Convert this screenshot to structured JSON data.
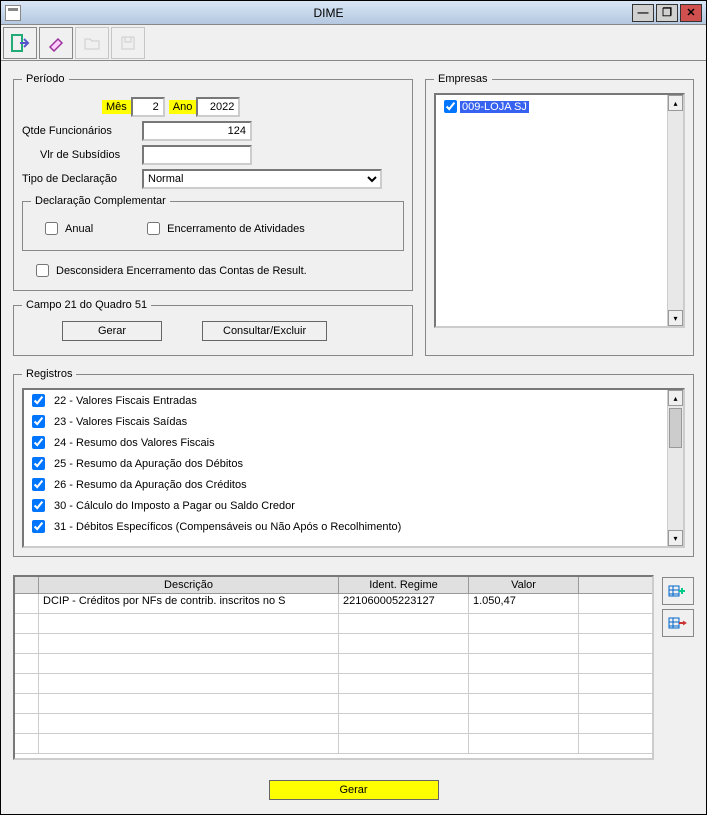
{
  "window": {
    "title": "DIME"
  },
  "titlebar_buttons": {
    "min": "—",
    "max": "❐",
    "close": "✕"
  },
  "toolbar": {
    "exit": "exit",
    "eraser": "eraser",
    "folder": "folder",
    "save": "save"
  },
  "periodo": {
    "legend": "Período",
    "mes_label": "Mês",
    "mes_value": "2",
    "ano_label": "Ano",
    "ano_value": "2022",
    "qtde_label": "Qtde Funcionários",
    "qtde_value": "124",
    "subsidios_label": "Vlr de Subsídios",
    "subsidios_value": "",
    "tipo_label": "Tipo de Declaração",
    "tipo_value": "Normal",
    "complementar_legend": "Declaração Complementar",
    "anual_label": "Anual",
    "enc_label": "Encerramento de Atividades",
    "desc_label": "Desconsidera Encerramento das Contas de Result."
  },
  "campo21": {
    "legend": "Campo 21 do Quadro 51",
    "gerar": "Gerar",
    "consultar": "Consultar/Excluir"
  },
  "empresas": {
    "legend": "Empresas",
    "items": [
      {
        "code": "009-LOJA SJ",
        "checked": true
      }
    ]
  },
  "registros": {
    "legend": "Registros",
    "items": [
      {
        "label": "22 - Valores Fiscais Entradas",
        "checked": true
      },
      {
        "label": "23 - Valores Fiscais Saídas",
        "checked": true
      },
      {
        "label": "24 - Resumo dos Valores Fiscais",
        "checked": true
      },
      {
        "label": "25 - Resumo da Apuração dos Débitos",
        "checked": true
      },
      {
        "label": "26 - Resumo da Apuração dos Créditos",
        "checked": true
      },
      {
        "label": "30 - Cálculo do Imposto a Pagar ou Saldo Credor",
        "checked": true
      },
      {
        "label": "31 - Débitos Específicos (Compensáveis ou Não Após o Recolhimento)",
        "checked": true
      }
    ]
  },
  "grid": {
    "headers": {
      "c1": "",
      "c2": "Descrição",
      "c3": "Ident. Regime",
      "c4": "Valor"
    },
    "rows": [
      {
        "c1": "",
        "c2": "DCIP - Créditos por NFs de contrib. inscritos no S",
        "c3": "221060005223127",
        "c4": "1.050,47"
      }
    ]
  },
  "bottom": {
    "gerar": "Gerar"
  }
}
